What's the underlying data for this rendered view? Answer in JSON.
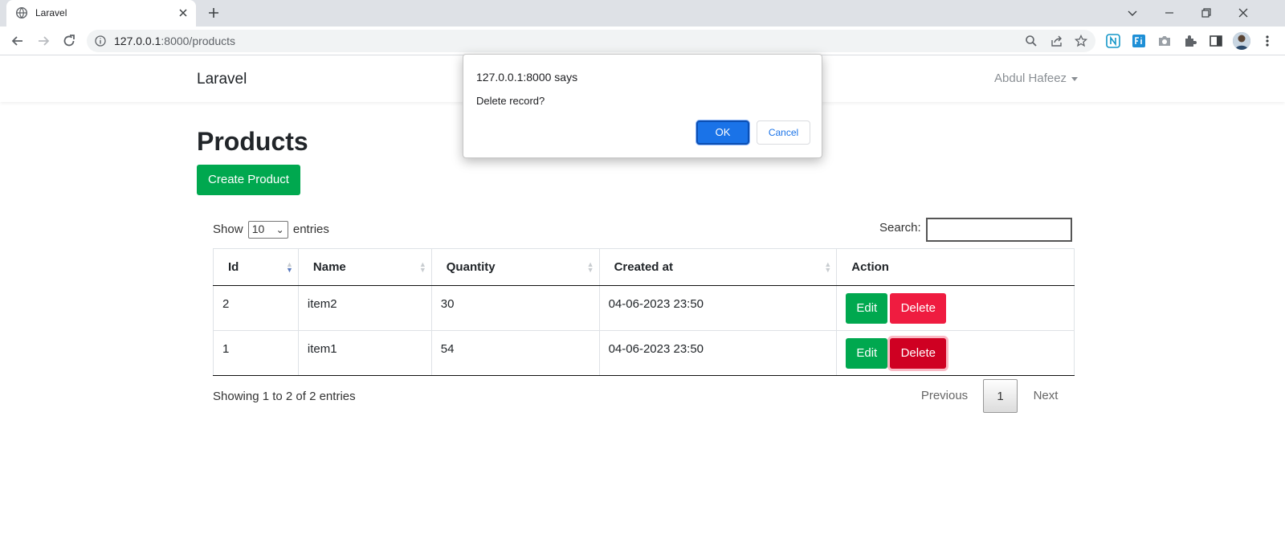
{
  "browser": {
    "tab_title": "Laravel",
    "url_host": "127.0.0.1",
    "url_rest": ":8000/products"
  },
  "app": {
    "brand": "Laravel",
    "user_name": "Abdul Hafeez"
  },
  "page": {
    "title": "Products",
    "create_button": "Create Product"
  },
  "datatable": {
    "length_prefix": "Show",
    "length_value": "10",
    "length_suffix": "entries",
    "search_label": "Search:",
    "search_value": "",
    "columns": [
      "Id",
      "Name",
      "Quantity",
      "Created at",
      "Action"
    ],
    "rows": [
      {
        "id": "2",
        "name": "item2",
        "quantity": "30",
        "created_at": "04-06-2023 23:50"
      },
      {
        "id": "1",
        "name": "item1",
        "quantity": "54",
        "created_at": "04-06-2023 23:50"
      }
    ],
    "edit_label": "Edit",
    "delete_label": "Delete",
    "info": "Showing 1 to 2 of 2 entries",
    "pagination": {
      "previous": "Previous",
      "current": "1",
      "next": "Next"
    }
  },
  "dialog": {
    "origin": "127.0.0.1:8000 says",
    "message": "Delete record?",
    "ok": "OK",
    "cancel": "Cancel"
  },
  "colors": {
    "success": "#00a84f",
    "danger": "#ef1c40",
    "dialog_ok": "#1a73e8"
  }
}
